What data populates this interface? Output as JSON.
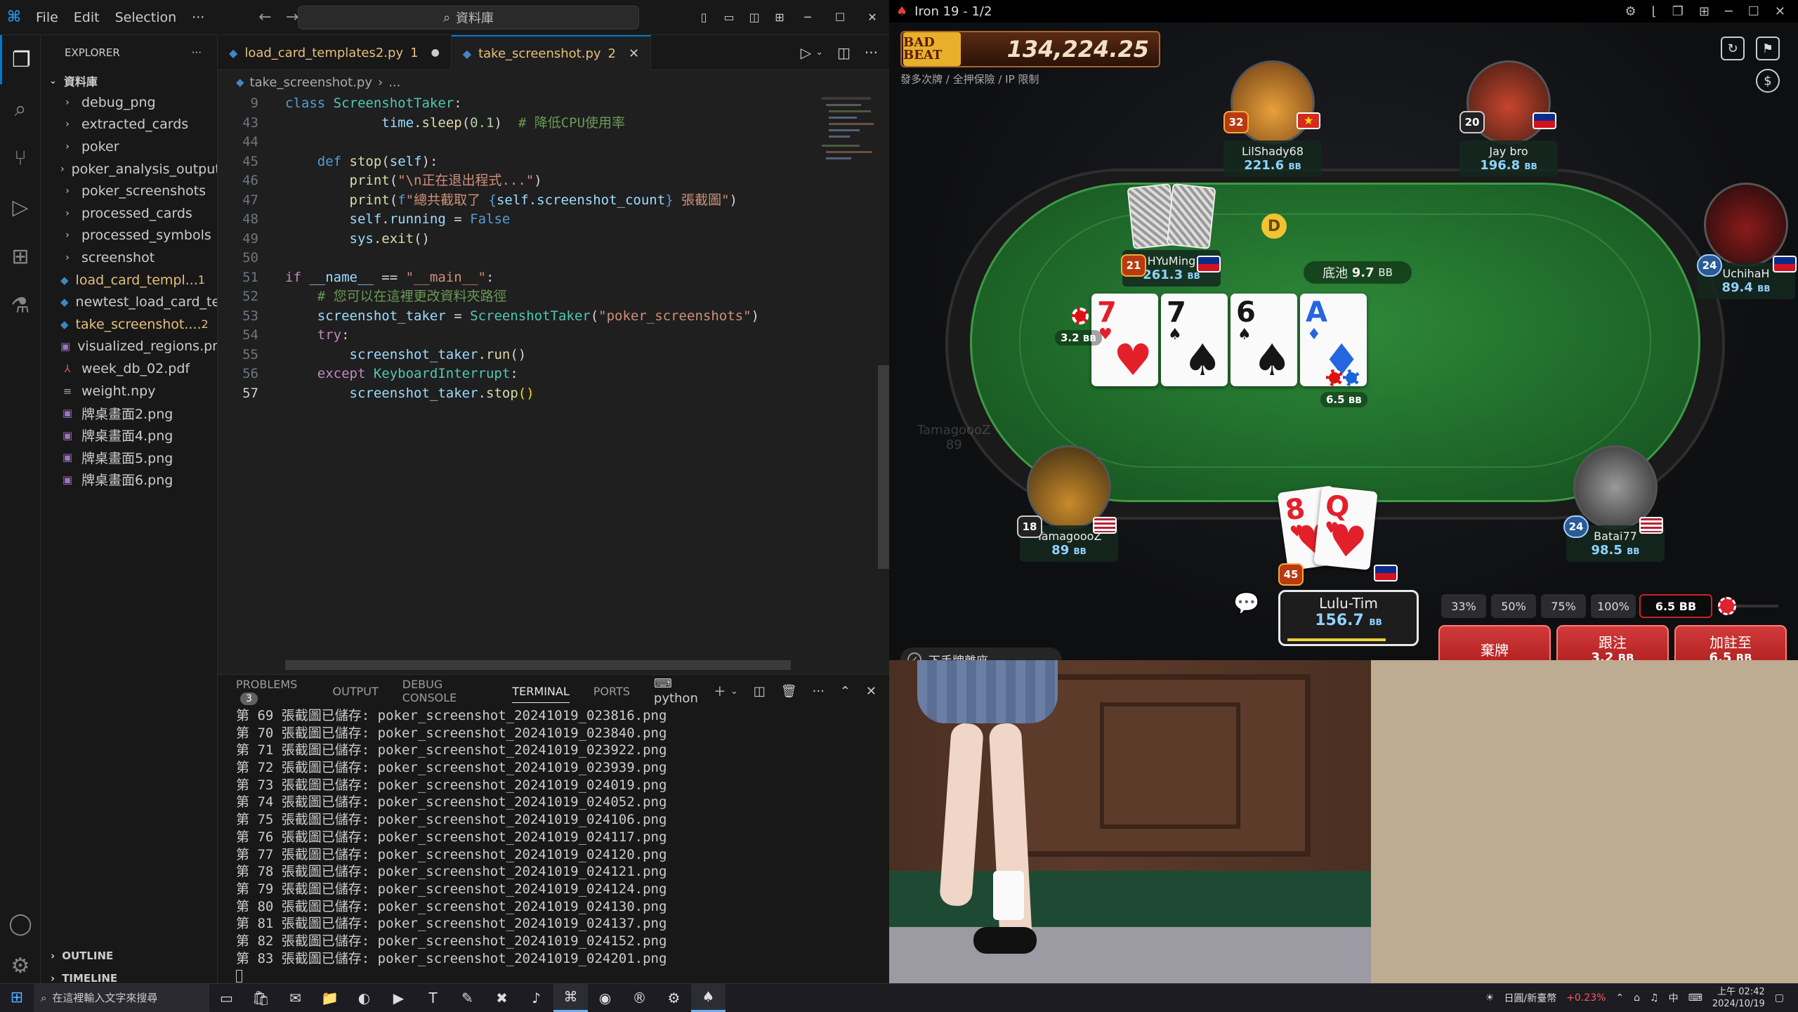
{
  "vscode": {
    "menu": [
      "File",
      "Edit",
      "Selection",
      "···"
    ],
    "search_text": "資料庫",
    "explorer_title": "EXPLORER",
    "root_folder": "資料庫",
    "tree": [
      {
        "label": "debug_png",
        "type": "folder"
      },
      {
        "label": "extracted_cards",
        "type": "folder"
      },
      {
        "label": "poker",
        "type": "folder"
      },
      {
        "label": "poker_analysis_output",
        "type": "folder"
      },
      {
        "label": "poker_screenshots",
        "type": "folder"
      },
      {
        "label": "processed_cards",
        "type": "folder"
      },
      {
        "label": "processed_symbols",
        "type": "folder"
      },
      {
        "label": "screenshot",
        "type": "folder"
      },
      {
        "label": "load_card_templ...",
        "type": "py",
        "badge": "1",
        "color": "#e5c07b"
      },
      {
        "label": "newtest_load_card_te...",
        "type": "py",
        "color": "#cccccc"
      },
      {
        "label": "take_screenshot....",
        "type": "py",
        "badge": "2",
        "color": "#e5c07b"
      },
      {
        "label": "visualized_regions.png",
        "type": "img",
        "color": "#cccccc"
      },
      {
        "label": "week_db_02.pdf",
        "type": "pdf",
        "color": "#cccccc"
      },
      {
        "label": "weight.npy",
        "type": "file",
        "color": "#cccccc"
      },
      {
        "label": "牌桌畫面2.png",
        "type": "img",
        "color": "#cccccc"
      },
      {
        "label": "牌桌畫面4.png",
        "type": "img",
        "color": "#cccccc"
      },
      {
        "label": "牌桌畫面5.png",
        "type": "img",
        "color": "#cccccc"
      },
      {
        "label": "牌桌畫面6.png",
        "type": "img",
        "color": "#cccccc"
      }
    ],
    "outline_label": "OUTLINE",
    "timeline_label": "TIMELINE",
    "tabs": [
      {
        "label": "load_card_templates2.py",
        "badge": "1",
        "modified": true
      },
      {
        "label": "take_screenshot.py",
        "badge": "2",
        "active": true
      }
    ],
    "breadcrumb": [
      "take_screenshot.py",
      "..."
    ],
    "code_lines": [
      {
        "n": "9",
        "tokens": [
          [
            "kw",
            "class "
          ],
          [
            "cls",
            "ScreenshotTaker"
          ],
          [
            "pl",
            ":"
          ]
        ]
      },
      {
        "n": "43",
        "tokens": [
          [
            "pl",
            "            "
          ],
          [
            "var",
            "time"
          ],
          [
            "pl",
            "."
          ],
          [
            "fn",
            "sleep"
          ],
          [
            "pl",
            "("
          ],
          [
            "num",
            "0.1"
          ],
          [
            "pl",
            ")  "
          ],
          [
            "cm",
            "# 降低CPU使用率"
          ]
        ]
      },
      {
        "n": "44",
        "tokens": []
      },
      {
        "n": "45",
        "tokens": [
          [
            "pl",
            "    "
          ],
          [
            "kw",
            "def "
          ],
          [
            "fn",
            "stop"
          ],
          [
            "pl",
            "("
          ],
          [
            "var",
            "self"
          ],
          [
            "pl",
            "):"
          ]
        ]
      },
      {
        "n": "46",
        "tokens": [
          [
            "pl",
            "        "
          ],
          [
            "fn",
            "print"
          ],
          [
            "pl",
            "("
          ],
          [
            "str",
            "\"\\n正在退出程式...\""
          ],
          [
            "pl",
            ")"
          ]
        ]
      },
      {
        "n": "47",
        "tokens": [
          [
            "pl",
            "        "
          ],
          [
            "fn",
            "print"
          ],
          [
            "pl",
            "("
          ],
          [
            "kw",
            "f"
          ],
          [
            "str",
            "\"總共截取了 "
          ],
          [
            "kw",
            "{"
          ],
          [
            "var",
            "self.screenshot_count"
          ],
          [
            "kw",
            "}"
          ],
          [
            "str",
            " 張截圖\""
          ],
          [
            "pl",
            ")"
          ]
        ]
      },
      {
        "n": "48",
        "tokens": [
          [
            "pl",
            "        "
          ],
          [
            "var",
            "self"
          ],
          [
            "pl",
            "."
          ],
          [
            "var",
            "running"
          ],
          [
            "pl",
            " = "
          ],
          [
            "kw",
            "False"
          ]
        ]
      },
      {
        "n": "49",
        "tokens": [
          [
            "pl",
            "        "
          ],
          [
            "var",
            "sys"
          ],
          [
            "pl",
            "."
          ],
          [
            "fn",
            "exit"
          ],
          [
            "pl",
            "()"
          ]
        ]
      },
      {
        "n": "50",
        "tokens": []
      },
      {
        "n": "51",
        "tokens": [
          [
            "kw2",
            "if "
          ],
          [
            "var",
            "__name__"
          ],
          [
            "pl",
            " == "
          ],
          [
            "str",
            "\"__main__\""
          ],
          [
            "pl",
            ":"
          ]
        ]
      },
      {
        "n": "52",
        "tokens": [
          [
            "pl",
            "    "
          ],
          [
            "cm",
            "# 您可以在這裡更改資料夾路徑"
          ]
        ]
      },
      {
        "n": "53",
        "tokens": [
          [
            "pl",
            "    "
          ],
          [
            "var",
            "screenshot_taker"
          ],
          [
            "pl",
            " = "
          ],
          [
            "cls",
            "ScreenshotTaker"
          ],
          [
            "pl",
            "("
          ],
          [
            "str",
            "\"poker_screenshots\""
          ],
          [
            "pl",
            ")"
          ]
        ]
      },
      {
        "n": "54",
        "tokens": [
          [
            "pl",
            "    "
          ],
          [
            "kw2",
            "try"
          ],
          [
            "pl",
            ":"
          ]
        ]
      },
      {
        "n": "55",
        "tokens": [
          [
            "pl",
            "        "
          ],
          [
            "var",
            "screenshot_taker"
          ],
          [
            "pl",
            "."
          ],
          [
            "fn",
            "run"
          ],
          [
            "pl",
            "()"
          ]
        ]
      },
      {
        "n": "56",
        "tokens": [
          [
            "pl",
            "    "
          ],
          [
            "kw2",
            "except "
          ],
          [
            "cls",
            "KeyboardInterrupt"
          ],
          [
            "pl",
            ":"
          ]
        ]
      },
      {
        "n": "57",
        "tokens": [
          [
            "pl",
            "        "
          ],
          [
            "var",
            "screenshot_taker"
          ],
          [
            "pl",
            "."
          ],
          [
            "fn",
            "stop"
          ],
          [
            "brace",
            "()"
          ]
        ]
      }
    ],
    "panel_tabs": [
      "PROBLEMS",
      "OUTPUT",
      "DEBUG CONSOLE",
      "TERMINAL",
      "PORTS"
    ],
    "problems_count": "3",
    "terminal_shell": "python",
    "terminal_lines": [
      "第 69 張截圖已儲存: poker_screenshot_20241019_023816.png",
      "第 70 張截圖已儲存: poker_screenshot_20241019_023840.png",
      "第 71 張截圖已儲存: poker_screenshot_20241019_023922.png",
      "第 72 張截圖已儲存: poker_screenshot_20241019_023939.png",
      "第 73 張截圖已儲存: poker_screenshot_20241019_024019.png",
      "第 74 張截圖已儲存: poker_screenshot_20241019_024052.png",
      "第 75 張截圖已儲存: poker_screenshot_20241019_024106.png",
      "第 76 張截圖已儲存: poker_screenshot_20241019_024117.png",
      "第 77 張截圖已儲存: poker_screenshot_20241019_024120.png",
      "第 78 張截圖已儲存: poker_screenshot_20241019_024121.png",
      "第 79 張截圖已儲存: poker_screenshot_20241019_024124.png",
      "第 80 張截圖已儲存: poker_screenshot_20241019_024130.png",
      "第 81 張截圖已儲存: poker_screenshot_20241019_024137.png",
      "第 82 張截圖已儲存: poker_screenshot_20241019_024152.png",
      "第 83 張截圖已儲存: poker_screenshot_20241019_024201.png"
    ]
  },
  "poker": {
    "window_title": "Iron 19 - 1/2",
    "badbeat_logo": "BAD BEAT",
    "badbeat_amount": "134,224.25",
    "table_rules": "發多次牌 / 全押保險 / IP 限制",
    "pot_label": "底池",
    "pot_value": "9.7",
    "bb_unit": "BB",
    "players": {
      "lilshady": {
        "name": "LilShady68",
        "stack": "221.6",
        "level": "32"
      },
      "jaybro": {
        "name": "Jay bro",
        "stack": "196.8",
        "level": "20"
      },
      "hyuming": {
        "name": "HYuMing",
        "stack": "261.3",
        "level": "21"
      },
      "uchihah": {
        "name": "UchihaH",
        "stack": "89.4",
        "level": "24"
      },
      "tamago": {
        "name": "TamagoooZ",
        "stack": "89",
        "level": "18"
      },
      "batai": {
        "name": "Batai77",
        "stack": "98.5",
        "level": "24"
      },
      "hero": {
        "name": "Lulu-Tim",
        "stack": "156.7",
        "level": "45"
      }
    },
    "ghost_name": "TamagoooZ",
    "ghost_stack": "89",
    "bet_hyuming": "3.2",
    "bet_hero": "6.5",
    "dealer": "D",
    "board": [
      {
        "rank": "7",
        "suit": "♥",
        "color": "red"
      },
      {
        "rank": "7",
        "suit": "♠",
        "color": "blk"
      },
      {
        "rank": "6",
        "suit": "♠",
        "color": "blk"
      },
      {
        "rank": "A",
        "suit": "♦",
        "color": "blu"
      }
    ],
    "hero_cards": [
      {
        "rank": "8",
        "suit": "♥",
        "color": "red"
      },
      {
        "rank": "Q",
        "suit": "♥",
        "color": "red"
      }
    ],
    "bet_pcts": [
      "33%",
      "50%",
      "75%",
      "100%"
    ],
    "raise_input": "6.5 BB",
    "actions": {
      "fold": "棄牌",
      "call": "跟注",
      "call_amt": "3.2",
      "raise": "加註至",
      "raise_amt": "6.5"
    },
    "autofold": "下手牌離座"
  },
  "taskbar": {
    "search_placeholder": "在這裡輸入文字來搜尋",
    "ticker": "日圓/新臺幣",
    "ticker_change": "+0.23%",
    "ime": "中",
    "time": "上午 02:42",
    "date": "2024/10/19"
  }
}
